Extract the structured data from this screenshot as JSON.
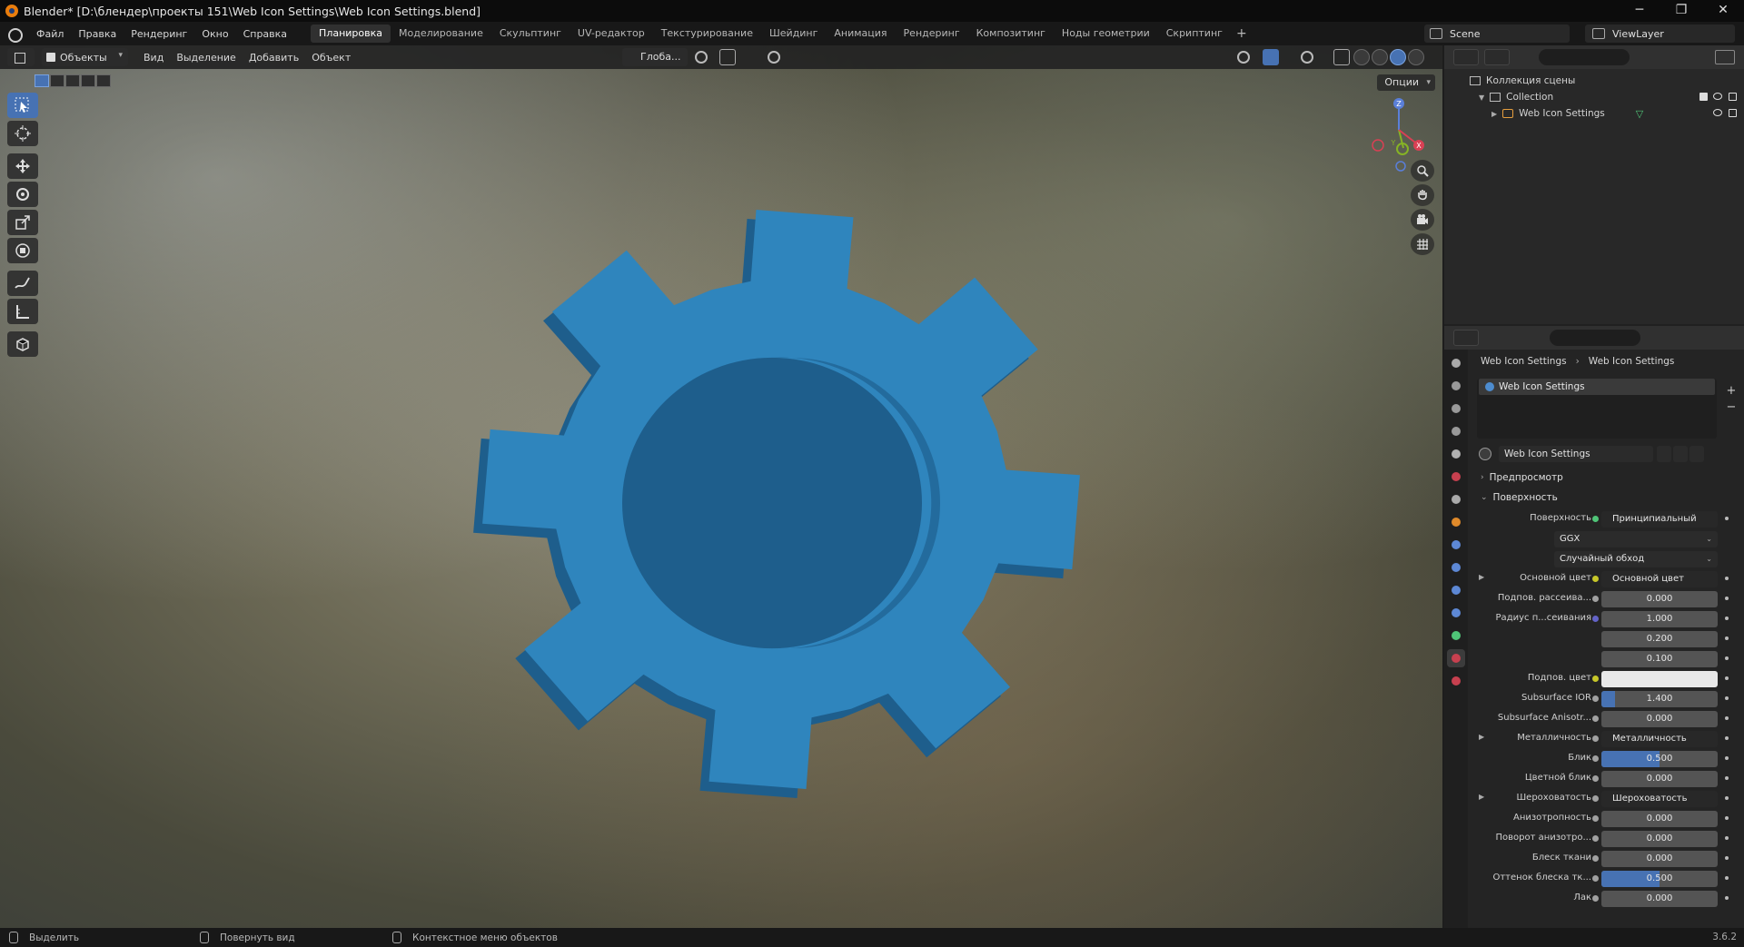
{
  "window": {
    "title": "Blender* [D:\\блендер\\проекты 151\\Web Icon Settings\\Web Icon Settings.blend]",
    "controls": [
      "─",
      "❐",
      "✕"
    ]
  },
  "menubar": {
    "menus": [
      "Файл",
      "Правка",
      "Рендеринг",
      "Окно",
      "Справка"
    ],
    "workspaces": [
      "Планировка",
      "Моделирование",
      "Скульптинг",
      "UV-редактор",
      "Текстурирование",
      "Шейдинг",
      "Анимация",
      "Рендеринг",
      "Композитинг",
      "Ноды геометрии",
      "Скриптинг"
    ],
    "active_workspace_index": 0,
    "add_tab": "+",
    "scene": "Scene",
    "view_layer": "ViewLayer"
  },
  "viewport": {
    "mode": "Объекты",
    "menus": [
      "Вид",
      "Выделение",
      "Добавить",
      "Объект"
    ],
    "transform_orientation": "Глоба...",
    "options": "Опции",
    "gizmo_axes": {
      "x": "X",
      "y": "Y",
      "z": "Z"
    },
    "object_color": "#2f85bd",
    "tools": [
      "select-box-icon",
      "cursor-icon",
      "move-icon",
      "rotate-icon",
      "scale-icon",
      "transform-icon",
      "annotate-icon",
      "measure-icon",
      "add-cube-icon"
    ],
    "nav_buttons": [
      "zoom-icon",
      "pan-hand-icon",
      "camera-icon",
      "grid-icon"
    ]
  },
  "outliner": {
    "rows": [
      {
        "label": "Коллекция сцены",
        "level": 0
      },
      {
        "label": "Collection",
        "level": 1
      },
      {
        "label": "Web Icon Settings",
        "level": 2
      }
    ]
  },
  "properties": {
    "breadcrumb": [
      "Web Icon Settings",
      "Web Icon Settings"
    ],
    "material_slot": "Web Icon Settings",
    "material_name": "Web Icon Settings",
    "panels": {
      "preview": "Предпросмотр",
      "surface": "Поверхность"
    },
    "rows": [
      {
        "label": "Поверхность",
        "value": "Принципиальный BSDF",
        "socket": "green",
        "type": "dark"
      },
      {
        "label": "",
        "value": "GGX",
        "type": "select"
      },
      {
        "label": "",
        "value": "Случайный обход",
        "type": "select"
      },
      {
        "label": "Основной цвет",
        "value": "Основной цвет",
        "socket": "yellow",
        "type": "dark",
        "expand": true
      },
      {
        "label": "Подпов. рассеива...",
        "value": "0.000",
        "socket": "gray",
        "type": "num",
        "fill": 0
      },
      {
        "label": "Радиус п...сеивания",
        "value": "1.000",
        "socket": "purple",
        "type": "num",
        "fill": 0
      },
      {
        "label": "",
        "value": "0.200",
        "type": "num",
        "fill": 0
      },
      {
        "label": "",
        "value": "0.100",
        "type": "num",
        "fill": 0
      },
      {
        "label": "Подпов. цвет",
        "value": "",
        "socket": "yellow",
        "type": "white"
      },
      {
        "label": "Subsurface IOR",
        "value": "1.400",
        "socket": "gray",
        "type": "num",
        "fill": 0.12
      },
      {
        "label": "Subsurface Anisotr...",
        "value": "0.000",
        "socket": "gray",
        "type": "num",
        "fill": 0
      },
      {
        "label": "Металличность",
        "value": "Металличность",
        "socket": "gray",
        "type": "dark",
        "expand": true
      },
      {
        "label": "Блик",
        "value": "0.500",
        "socket": "gray",
        "type": "num",
        "fill": 0.5
      },
      {
        "label": "Цветной блик",
        "value": "0.000",
        "socket": "gray",
        "type": "num",
        "fill": 0
      },
      {
        "label": "Шероховатость",
        "value": "Шероховатость",
        "socket": "gray",
        "type": "dark",
        "expand": true
      },
      {
        "label": "Анизотропность",
        "value": "0.000",
        "socket": "gray",
        "type": "num",
        "fill": 0
      },
      {
        "label": "Поворот анизотро...",
        "value": "0.000",
        "socket": "gray",
        "type": "num",
        "fill": 0
      },
      {
        "label": "Блеск ткани",
        "value": "0.000",
        "socket": "gray",
        "type": "num",
        "fill": 0
      },
      {
        "label": "Оттенок блеска тк...",
        "value": "0.500",
        "socket": "gray",
        "type": "num",
        "fill": 0.5
      },
      {
        "label": "Лак",
        "value": "0.000",
        "socket": "gray",
        "type": "num",
        "fill": 0
      }
    ]
  },
  "statusbar": {
    "select": "Выделить",
    "rotate": "Повернуть вид",
    "context": "Контекстное меню объектов",
    "version": "3.6.2"
  }
}
